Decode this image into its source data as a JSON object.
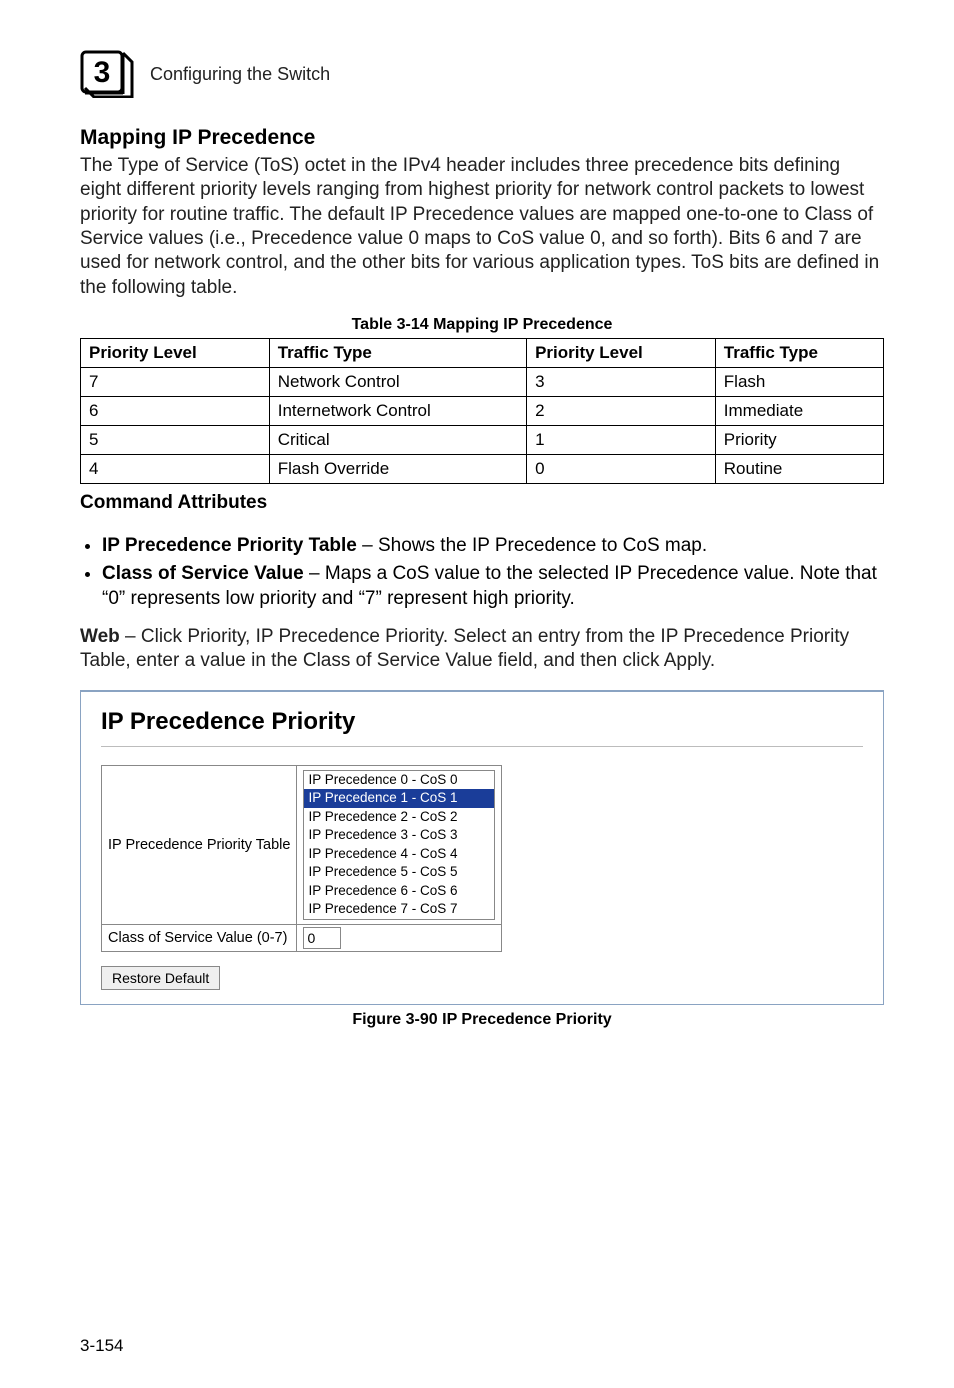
{
  "header": {
    "chapter_number": "3",
    "chapter_title": "Configuring the Switch"
  },
  "section": {
    "title": "Mapping IP Precedence",
    "intro": "The Type of Service (ToS) octet in the IPv4 header includes three precedence bits defining eight different priority levels ranging from highest priority for network control packets to lowest priority for routine traffic. The default IP Precedence values are mapped one-to-one to Class of Service values (i.e., Precedence value 0 maps to CoS value 0, and so forth). Bits 6 and 7 are used for network control, and the other bits for various application types. ToS bits are defined in the following table."
  },
  "table": {
    "caption": "Table 3-14   Mapping IP Precedence",
    "headers": [
      "Priority Level",
      "Traffic Type",
      "Priority Level",
      "Traffic Type"
    ],
    "rows": [
      [
        "7",
        "Network Control",
        "3",
        "Flash"
      ],
      [
        "6",
        "Internetwork Control",
        "2",
        "Immediate"
      ],
      [
        "5",
        "Critical",
        "1",
        "Priority"
      ],
      [
        "4",
        "Flash Override",
        "0",
        "Routine"
      ]
    ]
  },
  "cmd": {
    "heading": "Command Attributes",
    "item1_bold": "IP Precedence Priority Table",
    "item1_rest": " – Shows the IP Precedence to CoS map.",
    "item2_bold": "Class of Service Value",
    "item2_rest": " – Maps a CoS value to the selected IP Precedence value. Note that “0” represents low priority and “7” represent high priority."
  },
  "web": {
    "prefix": "Web",
    "text": " – Click Priority, IP Precedence Priority. Select an entry from the IP Precedence Priority Table, enter a value in the Class of Service Value field, and then click Apply."
  },
  "figure": {
    "panel_title": "IP Precedence Priority",
    "row1_label": "IP Precedence Priority Table",
    "listbox_items": [
      "IP Precedence 0 - CoS 0",
      "IP Precedence 1 - CoS 1",
      "IP Precedence 2 - CoS 2",
      "IP Precedence 3 - CoS 3",
      "IP Precedence 4 - CoS 4",
      "IP Precedence 5 - CoS 5",
      "IP Precedence 6 - CoS 6",
      "IP Precedence 7 - CoS 7"
    ],
    "selected_index": 1,
    "row2_label": "Class of Service Value (0-7)",
    "row2_value": "0",
    "restore_label": "Restore Default",
    "caption": "Figure 3-90   IP Precedence Priority"
  },
  "page_number": "3-154"
}
